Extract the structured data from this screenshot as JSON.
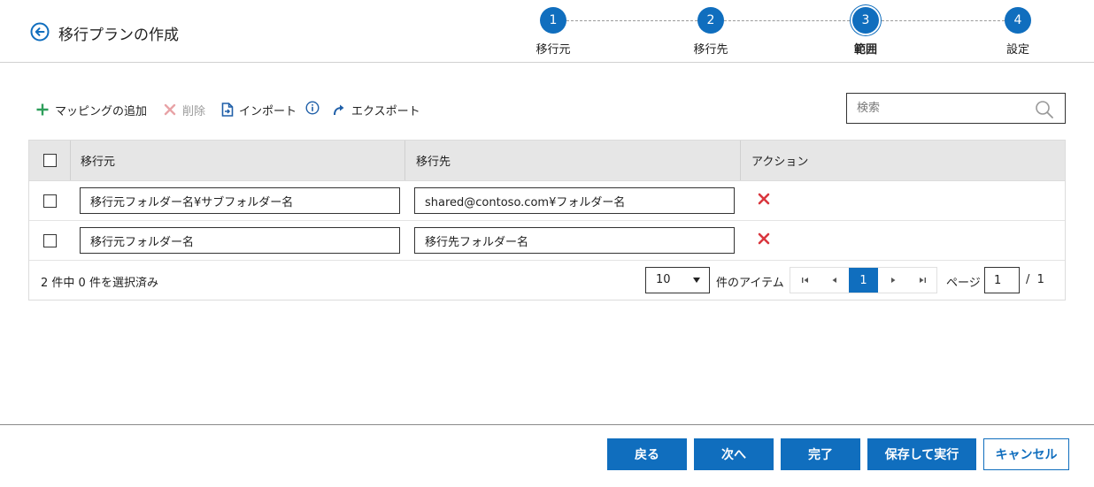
{
  "header": {
    "title": "移行プランの作成",
    "steps": [
      {
        "number": "1",
        "label": "移行元",
        "active": false
      },
      {
        "number": "2",
        "label": "移行先",
        "active": false
      },
      {
        "number": "3",
        "label": "範囲",
        "active": true
      },
      {
        "number": "4",
        "label": "設定",
        "active": false
      }
    ]
  },
  "toolbar": {
    "add_mapping": "マッピングの追加",
    "delete": "削除",
    "import": "インポート",
    "export": "エクスポート"
  },
  "search": {
    "placeholder": "検索",
    "value": ""
  },
  "table": {
    "columns": {
      "source": "移行元",
      "destination": "移行先",
      "action": "アクション"
    },
    "rows": [
      {
        "source": "移行元フォルダー名¥サブフォルダー名",
        "destination": "shared@contoso.com¥フォルダー名"
      },
      {
        "source": "移行元フォルダー名",
        "destination": "移行先フォルダー名"
      }
    ]
  },
  "pagination": {
    "selection_status": "2 件中 0 件を選択済み",
    "page_size": "10",
    "items_label": "件のアイテム",
    "current_page": "1",
    "page_label": "ページ",
    "page_input": "1",
    "total_pages": "/  1"
  },
  "footer": {
    "back": "戻る",
    "next": "次へ",
    "finish": "完了",
    "save_run": "保存して実行",
    "cancel": "キャンセル"
  },
  "colors": {
    "accent": "#106ebe",
    "delete_red": "#d9363e",
    "add_green": "#2e9e5b"
  }
}
